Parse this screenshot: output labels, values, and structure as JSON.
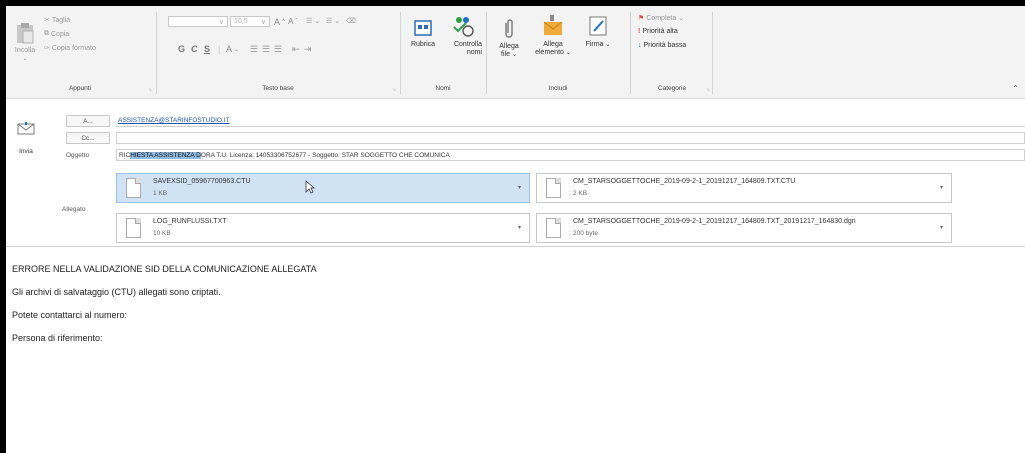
{
  "ribbon": {
    "appunti": {
      "label": "Appunti",
      "paste_label": "Incolla",
      "cut_label": "Taglia",
      "copy_label": "Copia",
      "format_painter_label": "Copia formato"
    },
    "testo_base": {
      "label": "Testo base",
      "font_size": "10,5",
      "grow_label": "A",
      "shrink_label": "A",
      "bold": "G",
      "italic": "C",
      "underline": "S"
    },
    "nomi": {
      "label": "Nomi",
      "address_book_label": "Rubrica",
      "check_names_label": "Controlla nomi"
    },
    "includi": {
      "label": "Includi",
      "attach_file_label": "Allega file",
      "attach_item_label": "Allega elemento",
      "signature_label": "Firma"
    },
    "categorie": {
      "label": "Categorie",
      "followup_label": "Completa",
      "high_priority_label": "Priorità alta",
      "low_priority_label": "Priorità bassa"
    }
  },
  "header": {
    "send_label": "Invia",
    "to_label": "A...",
    "cc_label": "Cc...",
    "subject_label": "Oggetto",
    "attachments_label": "Allegato",
    "to_value": "ASSISTENZA@STARINFOSTUDIO.IT",
    "cc_value": "",
    "subject_prefix": "RIC",
    "subject_highlight": "HIESTA ASSISTENZA D",
    "subject_rest": "ORA T.U. Licenza: 14053306752677 - Soggetto: STAR SOGGETTO CHE COMUNICA"
  },
  "attachments": [
    {
      "name": "SAVEXSID_05967700963.CTU",
      "size": "1 KB"
    },
    {
      "name": "CM_STARSOGGETTOCHE_2019-09-2-1_20191217_164809.TXT.CTU",
      "size": "2 KB"
    },
    {
      "name": "LOG_RUNFLUSSI.TXT",
      "size": "10 KB"
    },
    {
      "name": "CM_STARSOGGETTOCHE_2019-09-2-1_20191217_164809.TXT_20191217_164830.dgn",
      "size": "200 byte"
    }
  ],
  "body": {
    "line1": "ERRORE NELLA VALIDAZIONE SID DELLA COMUNICAZIONE ALLEGATA",
    "line2": "Gli archivi di salvataggio (CTU) allegati sono criptati.",
    "line3": "Potete contattarci al numero:",
    "line4": "Persona di riferimento:"
  },
  "colors": {
    "selection": "#cfe3f5",
    "ribbon_bg": "#f3f3f3",
    "outer_frame": "#000000"
  }
}
